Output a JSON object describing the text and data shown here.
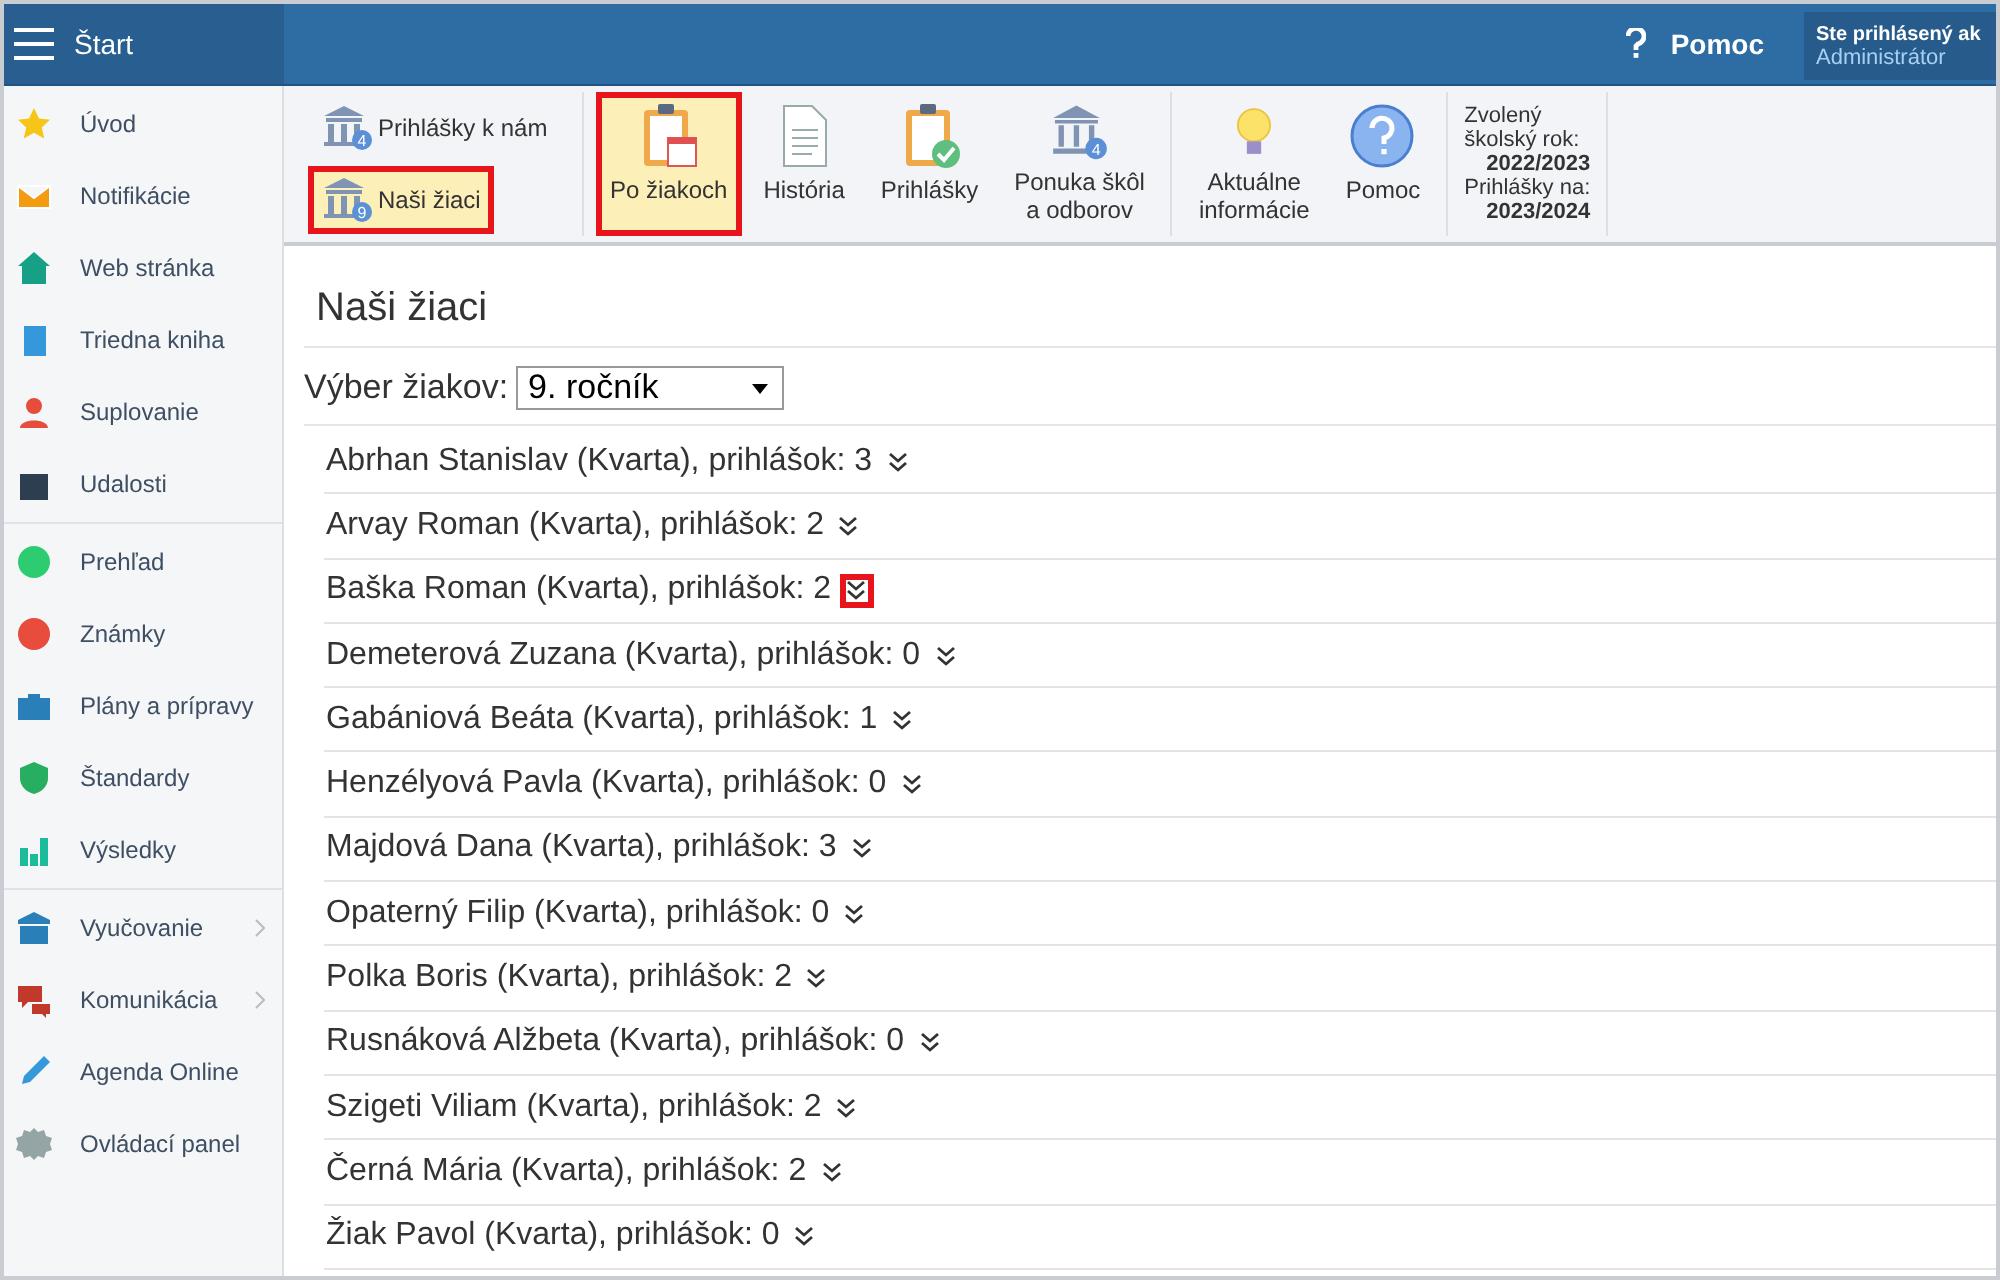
{
  "topbar": {
    "title": "Štart",
    "help": "Pomoc",
    "user_line": "Ste prihlásený ak",
    "user_name": "Administrátor"
  },
  "sidebar": {
    "groups": [
      [
        {
          "label": "Úvod",
          "submenu": false
        },
        {
          "label": "Notifikácie",
          "submenu": false
        },
        {
          "label": "Web stránka",
          "submenu": false
        },
        {
          "label": "Triedna kniha",
          "submenu": false
        },
        {
          "label": "Suplovanie",
          "submenu": false
        },
        {
          "label": "Udalosti",
          "submenu": false
        }
      ],
      [
        {
          "label": "Prehľad",
          "submenu": false
        },
        {
          "label": "Známky",
          "submenu": false
        },
        {
          "label": "Plány a prípravy",
          "submenu": false
        },
        {
          "label": "Štandardy",
          "submenu": false
        },
        {
          "label": "Výsledky",
          "submenu": false
        }
      ],
      [
        {
          "label": "Vyučovanie",
          "submenu": true
        },
        {
          "label": "Komunikácia",
          "submenu": true
        },
        {
          "label": "Agenda Online",
          "submenu": false
        },
        {
          "label": "Ovládací panel",
          "submenu": false
        }
      ]
    ]
  },
  "ribbon": {
    "small_buttons": [
      {
        "label": "Prihlášky k nám",
        "badge": "4",
        "selected": false,
        "highlighted": false
      },
      {
        "label": "Naši žiaci",
        "badge": "9",
        "selected": true,
        "highlighted": true
      }
    ],
    "groups": [
      [
        {
          "label": "Po žiakoch",
          "selected": true,
          "highlighted": true
        },
        {
          "label": "História",
          "selected": false,
          "highlighted": false
        },
        {
          "label": "Prihlášky",
          "selected": false,
          "highlighted": false
        },
        {
          "label": "Ponuka škôl\na odborov",
          "badge": "4",
          "selected": false,
          "highlighted": false
        }
      ],
      [
        {
          "label": "Aktuálne\ninformácie",
          "selected": false,
          "highlighted": false
        },
        {
          "label": "Pomoc",
          "selected": false,
          "highlighted": false
        }
      ]
    ],
    "info": {
      "year_label": "Zvolený\nškolský rok:",
      "year": "2022/2023",
      "apps_label": "Prihlášky na:",
      "apps_year": "2023/2024"
    }
  },
  "page": {
    "title": "Naši žiaci",
    "filter_label": "Výber žiakov:",
    "filter_value": "9. ročník",
    "students": [
      {
        "text": "Abrhan Stanislav (Kvarta), prihlášok: 3",
        "highlighted": false
      },
      {
        "text": "Arvay Roman (Kvarta), prihlášok: 2",
        "highlighted": false
      },
      {
        "text": "Baška Roman (Kvarta), prihlášok: 2",
        "highlighted": true
      },
      {
        "text": "Demeterová Zuzana (Kvarta), prihlášok: 0",
        "highlighted": false
      },
      {
        "text": "Gabániová Beáta (Kvarta), prihlášok: 1",
        "highlighted": false
      },
      {
        "text": "Henzélyová Pavla (Kvarta), prihlášok: 0",
        "highlighted": false
      },
      {
        "text": "Majdová Dana (Kvarta), prihlášok: 3",
        "highlighted": false
      },
      {
        "text": "Opaterný Filip (Kvarta), prihlášok: 0",
        "highlighted": false
      },
      {
        "text": "Polka Boris (Kvarta), prihlášok: 2",
        "highlighted": false
      },
      {
        "text": "Rusnáková Alžbeta (Kvarta), prihlášok: 0",
        "highlighted": false
      },
      {
        "text": "Szigeti Viliam (Kvarta), prihlášok: 2",
        "highlighted": false
      },
      {
        "text": "Černá Mária (Kvarta), prihlášok: 2",
        "highlighted": false
      },
      {
        "text": "Žiak Pavol (Kvarta), prihlášok: 0",
        "highlighted": false
      }
    ]
  }
}
